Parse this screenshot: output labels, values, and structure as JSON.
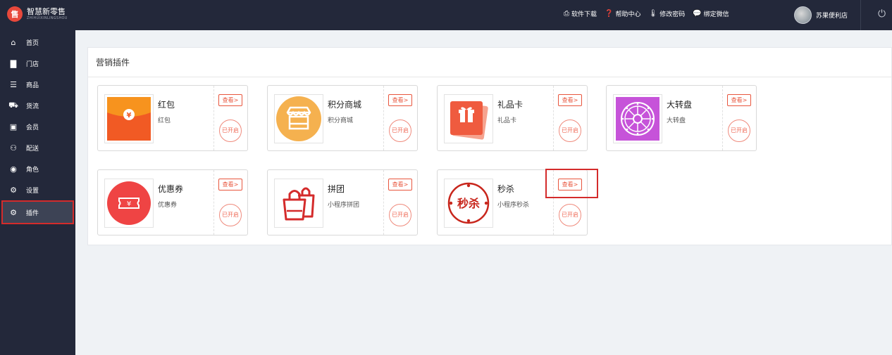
{
  "app": {
    "logo_glyph": "售",
    "name_cn": "智慧新零售",
    "name_en": "ZHIHUIXINLINGSHOU"
  },
  "topnav": [
    {
      "icon": "software-download-icon",
      "label": "软件下载"
    },
    {
      "icon": "help-icon",
      "label": "帮助中心"
    },
    {
      "icon": "thermometer-icon",
      "label": "修改密码"
    },
    {
      "icon": "wechat-icon",
      "label": "绑定微信"
    }
  ],
  "user": {
    "name": "苏果便利店"
  },
  "sidebar": {
    "items": [
      {
        "label": "首页",
        "icon": "home-icon"
      },
      {
        "label": "门店",
        "icon": "building-icon"
      },
      {
        "label": "商品",
        "icon": "list-icon"
      },
      {
        "label": "货流",
        "icon": "truck-icon"
      },
      {
        "label": "会员",
        "icon": "id-card-icon"
      },
      {
        "label": "配送",
        "icon": "motorcycle-icon"
      },
      {
        "label": "角色",
        "icon": "user-circle-icon"
      },
      {
        "label": "设置",
        "icon": "gear-icon"
      },
      {
        "label": "插件",
        "icon": "gears-icon"
      }
    ],
    "active_index": 8
  },
  "panel": {
    "title": "营销插件"
  },
  "plugins": [
    {
      "name": "红包",
      "desc": "红包",
      "view": "查看>",
      "status": "已开启",
      "icon": "red-envelope-icon"
    },
    {
      "name": "积分商城",
      "desc": "积分商城",
      "view": "查看>",
      "status": "已开启",
      "icon": "store-icon"
    },
    {
      "name": "礼品卡",
      "desc": "礼品卡",
      "view": "查看>",
      "status": "已开启",
      "icon": "gift-card-icon"
    },
    {
      "name": "大转盘",
      "desc": "大转盘",
      "view": "查看>",
      "status": "已开启",
      "icon": "wheel-icon"
    },
    {
      "name": "优惠券",
      "desc": "优惠券",
      "view": "查看>",
      "status": "已开启",
      "icon": "coupon-icon"
    },
    {
      "name": "拼团",
      "desc": "小程序拼团",
      "view": "查看>",
      "status": "已开启",
      "icon": "shopping-bag-icon"
    },
    {
      "name": "秒杀",
      "desc": "小程序秒杀",
      "view": "查看>",
      "status": "已开启",
      "icon": "flash-sale-icon",
      "flash_text": "秒杀"
    }
  ],
  "coupon_symbol": "¥",
  "envelope_symbol": "¥",
  "colors": {
    "topbar": "#23283a",
    "accent": "#e8553d",
    "highlight": "#d42b2b"
  }
}
